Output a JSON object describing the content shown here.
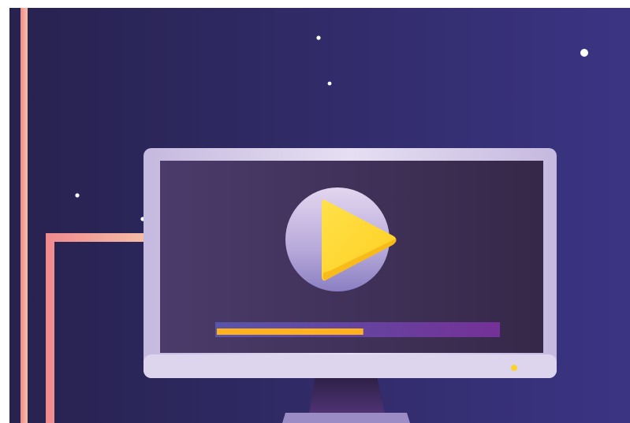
{
  "scene": {
    "colors": {
      "background_left": "#27224e",
      "background_right": "#3b3483",
      "cable_outer": "#f08a8e",
      "cable_inner": "#f6c0a7",
      "monitor_frame": "#c5b9df",
      "monitor_frame_light": "#e6dff2",
      "screen_left": "#4b3b6b",
      "screen_right": "#362848",
      "play_circle_top": "#e3d6f0",
      "play_circle_bottom": "#8a7fc2",
      "play_triangle": "#ffcf1f",
      "progress_filled": "#ffb21d",
      "progress_track_left": "#5855a9",
      "progress_track_right": "#743197",
      "power_led": "#ffd22a",
      "stand": "#4f3374",
      "stars": "#ffffff"
    },
    "icons": {
      "monitor": "desktop-monitor-icon",
      "play": "play-icon",
      "cable": "power-cable-icon"
    },
    "video_progress": 0.52,
    "star_count": 6
  }
}
